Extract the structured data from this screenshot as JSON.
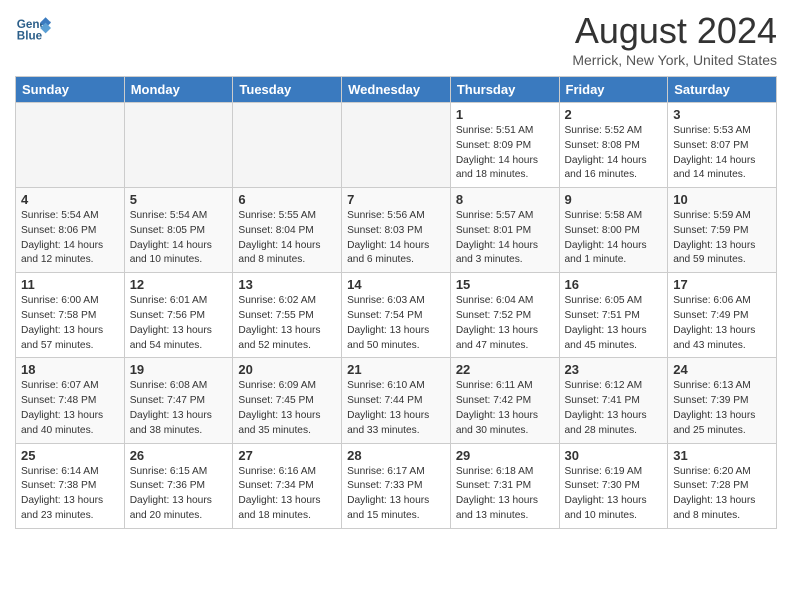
{
  "header": {
    "logo_line1": "General",
    "logo_line2": "Blue",
    "month_title": "August 2024",
    "location": "Merrick, New York, United States"
  },
  "weekdays": [
    "Sunday",
    "Monday",
    "Tuesday",
    "Wednesday",
    "Thursday",
    "Friday",
    "Saturday"
  ],
  "weeks": [
    [
      {
        "day": "",
        "info": ""
      },
      {
        "day": "",
        "info": ""
      },
      {
        "day": "",
        "info": ""
      },
      {
        "day": "",
        "info": ""
      },
      {
        "day": "1",
        "info": "Sunrise: 5:51 AM\nSunset: 8:09 PM\nDaylight: 14 hours\nand 18 minutes."
      },
      {
        "day": "2",
        "info": "Sunrise: 5:52 AM\nSunset: 8:08 PM\nDaylight: 14 hours\nand 16 minutes."
      },
      {
        "day": "3",
        "info": "Sunrise: 5:53 AM\nSunset: 8:07 PM\nDaylight: 14 hours\nand 14 minutes."
      }
    ],
    [
      {
        "day": "4",
        "info": "Sunrise: 5:54 AM\nSunset: 8:06 PM\nDaylight: 14 hours\nand 12 minutes."
      },
      {
        "day": "5",
        "info": "Sunrise: 5:54 AM\nSunset: 8:05 PM\nDaylight: 14 hours\nand 10 minutes."
      },
      {
        "day": "6",
        "info": "Sunrise: 5:55 AM\nSunset: 8:04 PM\nDaylight: 14 hours\nand 8 minutes."
      },
      {
        "day": "7",
        "info": "Sunrise: 5:56 AM\nSunset: 8:03 PM\nDaylight: 14 hours\nand 6 minutes."
      },
      {
        "day": "8",
        "info": "Sunrise: 5:57 AM\nSunset: 8:01 PM\nDaylight: 14 hours\nand 3 minutes."
      },
      {
        "day": "9",
        "info": "Sunrise: 5:58 AM\nSunset: 8:00 PM\nDaylight: 14 hours\nand 1 minute."
      },
      {
        "day": "10",
        "info": "Sunrise: 5:59 AM\nSunset: 7:59 PM\nDaylight: 13 hours\nand 59 minutes."
      }
    ],
    [
      {
        "day": "11",
        "info": "Sunrise: 6:00 AM\nSunset: 7:58 PM\nDaylight: 13 hours\nand 57 minutes."
      },
      {
        "day": "12",
        "info": "Sunrise: 6:01 AM\nSunset: 7:56 PM\nDaylight: 13 hours\nand 54 minutes."
      },
      {
        "day": "13",
        "info": "Sunrise: 6:02 AM\nSunset: 7:55 PM\nDaylight: 13 hours\nand 52 minutes."
      },
      {
        "day": "14",
        "info": "Sunrise: 6:03 AM\nSunset: 7:54 PM\nDaylight: 13 hours\nand 50 minutes."
      },
      {
        "day": "15",
        "info": "Sunrise: 6:04 AM\nSunset: 7:52 PM\nDaylight: 13 hours\nand 47 minutes."
      },
      {
        "day": "16",
        "info": "Sunrise: 6:05 AM\nSunset: 7:51 PM\nDaylight: 13 hours\nand 45 minutes."
      },
      {
        "day": "17",
        "info": "Sunrise: 6:06 AM\nSunset: 7:49 PM\nDaylight: 13 hours\nand 43 minutes."
      }
    ],
    [
      {
        "day": "18",
        "info": "Sunrise: 6:07 AM\nSunset: 7:48 PM\nDaylight: 13 hours\nand 40 minutes."
      },
      {
        "day": "19",
        "info": "Sunrise: 6:08 AM\nSunset: 7:47 PM\nDaylight: 13 hours\nand 38 minutes."
      },
      {
        "day": "20",
        "info": "Sunrise: 6:09 AM\nSunset: 7:45 PM\nDaylight: 13 hours\nand 35 minutes."
      },
      {
        "day": "21",
        "info": "Sunrise: 6:10 AM\nSunset: 7:44 PM\nDaylight: 13 hours\nand 33 minutes."
      },
      {
        "day": "22",
        "info": "Sunrise: 6:11 AM\nSunset: 7:42 PM\nDaylight: 13 hours\nand 30 minutes."
      },
      {
        "day": "23",
        "info": "Sunrise: 6:12 AM\nSunset: 7:41 PM\nDaylight: 13 hours\nand 28 minutes."
      },
      {
        "day": "24",
        "info": "Sunrise: 6:13 AM\nSunset: 7:39 PM\nDaylight: 13 hours\nand 25 minutes."
      }
    ],
    [
      {
        "day": "25",
        "info": "Sunrise: 6:14 AM\nSunset: 7:38 PM\nDaylight: 13 hours\nand 23 minutes."
      },
      {
        "day": "26",
        "info": "Sunrise: 6:15 AM\nSunset: 7:36 PM\nDaylight: 13 hours\nand 20 minutes."
      },
      {
        "day": "27",
        "info": "Sunrise: 6:16 AM\nSunset: 7:34 PM\nDaylight: 13 hours\nand 18 minutes."
      },
      {
        "day": "28",
        "info": "Sunrise: 6:17 AM\nSunset: 7:33 PM\nDaylight: 13 hours\nand 15 minutes."
      },
      {
        "day": "29",
        "info": "Sunrise: 6:18 AM\nSunset: 7:31 PM\nDaylight: 13 hours\nand 13 minutes."
      },
      {
        "day": "30",
        "info": "Sunrise: 6:19 AM\nSunset: 7:30 PM\nDaylight: 13 hours\nand 10 minutes."
      },
      {
        "day": "31",
        "info": "Sunrise: 6:20 AM\nSunset: 7:28 PM\nDaylight: 13 hours\nand 8 minutes."
      }
    ]
  ]
}
